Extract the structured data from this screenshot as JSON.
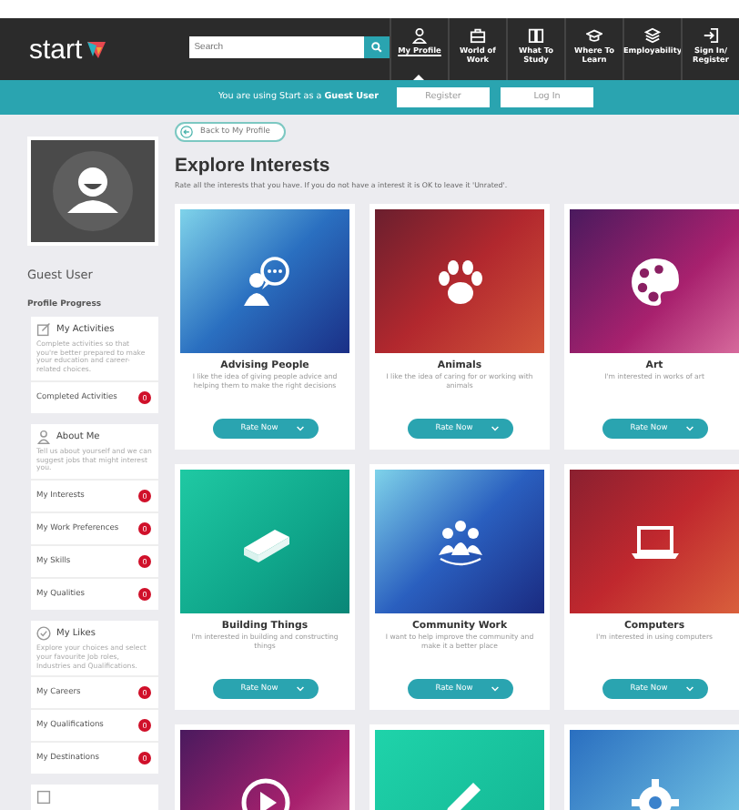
{
  "nav": {
    "logo": "start",
    "search": {
      "placeholder": "Search"
    },
    "items": [
      {
        "label": "My Profile",
        "selected": true
      },
      {
        "label": "World of Work",
        "selected": false
      },
      {
        "label": "What To Study",
        "selected": false
      },
      {
        "label": "Where To Learn",
        "selected": false
      },
      {
        "label": "Employability",
        "selected": false
      },
      {
        "label": "Sign In/ Register",
        "selected": false
      }
    ]
  },
  "banner": {
    "text": "You are using Start as a **Guest User**",
    "buttons": [
      "Register",
      "Log In"
    ]
  },
  "sidebar": {
    "user": "Guest User",
    "progress_title": "Profile Progress",
    "sections": [
      {
        "title": "My Activities",
        "description": "Complete activities so that you're better prepared to make your education and career-related choices.",
        "items": [
          {
            "label": "Completed Activities",
            "count": "0"
          }
        ]
      },
      {
        "title": "About Me",
        "description": "Tell us about yourself and we can suggest jobs that might interest you.",
        "items": [
          {
            "label": "My Interests",
            "count": "0"
          },
          {
            "label": "My Work Preferences",
            "count": "0"
          },
          {
            "label": "My Skills",
            "count": "0"
          },
          {
            "label": "My Qualities",
            "count": "0"
          }
        ]
      },
      {
        "title": "My Likes",
        "description": "Explore your choices and select your favourite Job roles, Industries and Qualifications.",
        "items": [
          {
            "label": "My Careers",
            "count": "0"
          },
          {
            "label": "My Qualifications",
            "count": "0"
          },
          {
            "label": "My Destinations",
            "count": "0"
          }
        ]
      },
      {
        "kind": "cut-off"
      }
    ]
  },
  "main": {
    "back": "Back to My Profile",
    "title": "Explore Interests",
    "subtitle": "Rate all the interests that you have. If you do not have a interest it is OK to leave it 'Unrated'.",
    "cards": [
      {
        "kind": "full",
        "title": "Advising People",
        "description": "I like the idea of giving people advice and helping them to make the right decisions",
        "button": "Rate Now"
      },
      {
        "kind": "full",
        "title": "Animals",
        "description": "I like the idea of caring for or working with animals",
        "button": "Rate Now"
      },
      {
        "kind": "full",
        "title": "Art",
        "description": "I'm interested in works of art",
        "button": "Rate Now"
      },
      {
        "kind": "full",
        "title": "Building Things",
        "description": "I'm interested in building and constructing things",
        "button": "Rate Now"
      },
      {
        "kind": "full",
        "title": "Community Work",
        "description": "I want to help improve the community and make it a better place",
        "button": "Rate Now"
      },
      {
        "kind": "full",
        "title": "Computers",
        "description": "I'm interested in using computers",
        "button": "Rate Now"
      },
      {
        "kind": "cut-off"
      },
      {
        "kind": "cut-off"
      },
      {
        "kind": "cut-off"
      }
    ]
  }
}
